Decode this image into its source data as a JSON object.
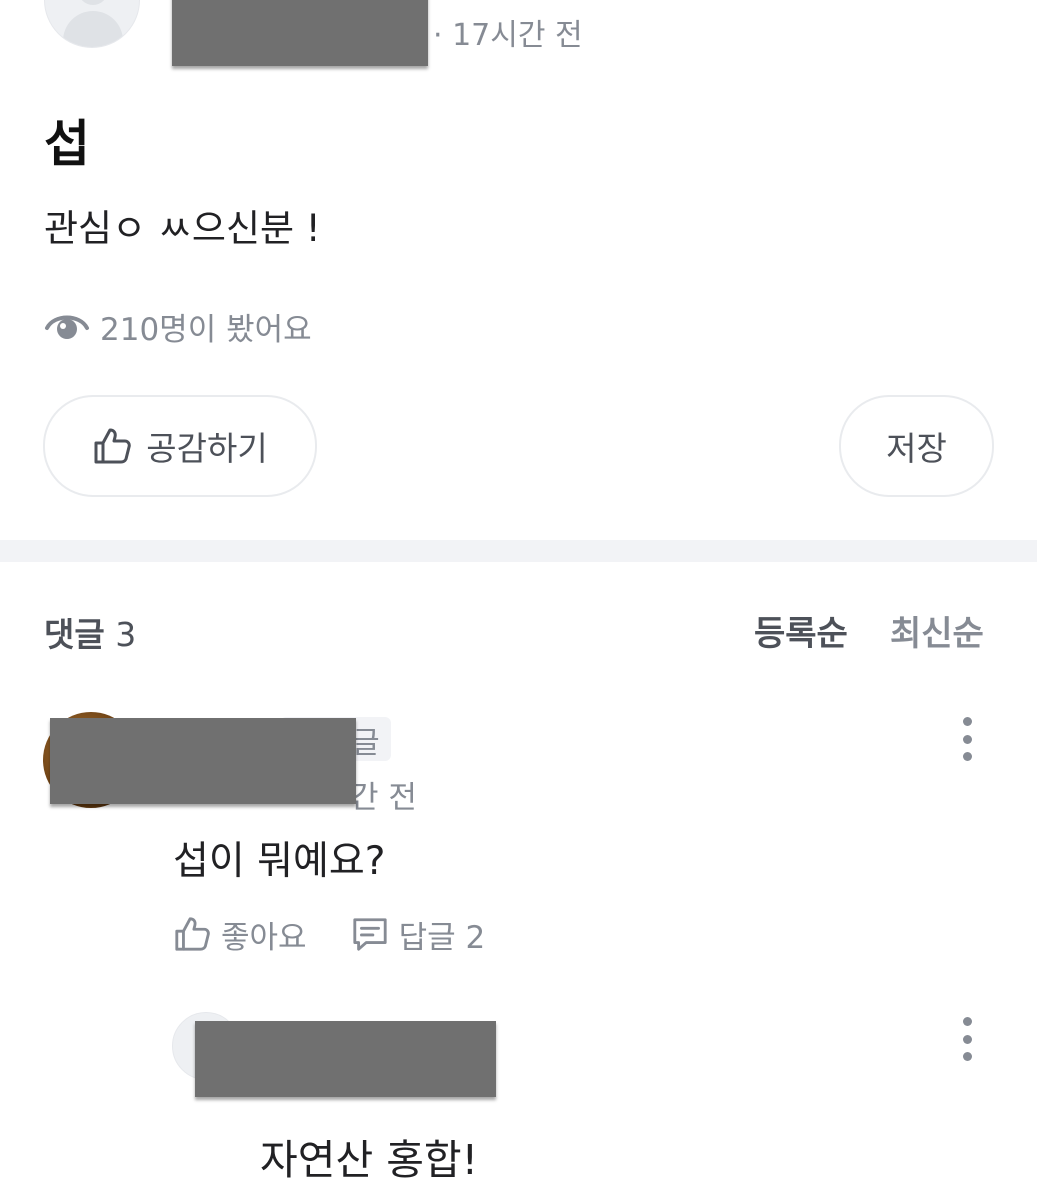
{
  "post": {
    "time": "· 17시간 전",
    "title": "섭",
    "body": "관심ㅇ ㅆ으신분 !",
    "views": "210명이 봤어요",
    "like_label": "공감하기",
    "save_label": "저장"
  },
  "comments_header": {
    "title": "댓글",
    "count": "3",
    "sort_registered": "등록순",
    "sort_latest": "최신순"
  },
  "comment": {
    "author_tag": "글",
    "time": "간 전",
    "text": "섭이 뭐예요?",
    "like_label": "좋아요",
    "reply_label": "답글 2"
  },
  "reply": {
    "text": "자연산 홍합!"
  },
  "colors": {
    "muted_text": "#868b94",
    "divider": "#f2f3f6",
    "redaction": "#707070"
  },
  "icons": [
    "eye-icon",
    "thumbs-up-icon",
    "reply-bubble-icon",
    "more-vertical-icon"
  ]
}
